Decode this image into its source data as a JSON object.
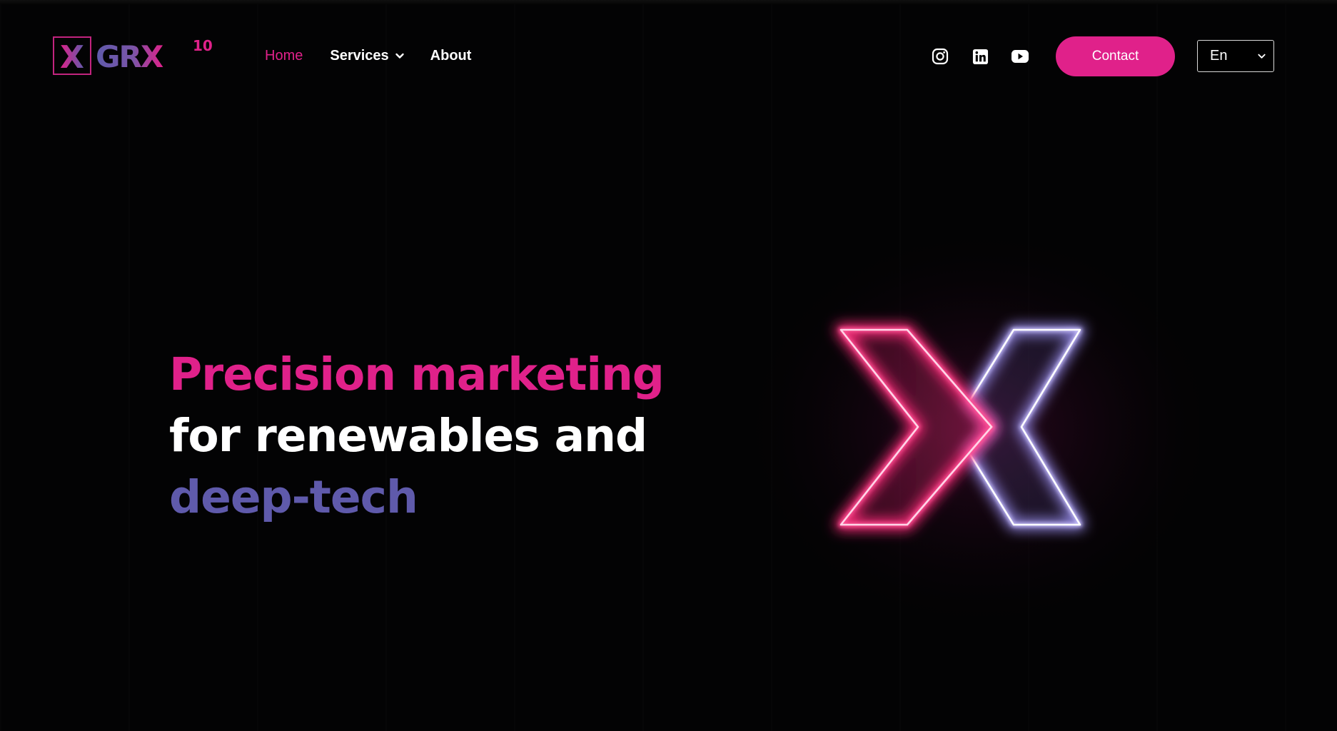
{
  "brand": {
    "logo_text": "GRX",
    "logo_superscript": "10",
    "logo_mark": "X"
  },
  "nav": {
    "items": [
      {
        "label": "Home",
        "active": true
      },
      {
        "label": "Services",
        "has_dropdown": true
      },
      {
        "label": "About"
      }
    ]
  },
  "social": [
    {
      "icon": "instagram-icon"
    },
    {
      "icon": "linkedin-icon"
    },
    {
      "icon": "youtube-icon"
    }
  ],
  "contact_label": "Contact",
  "language": {
    "selected": "En"
  },
  "hero": {
    "line1": "Precision marketing",
    "line2": "for renewables and",
    "line3": "deep-tech"
  },
  "colors": {
    "accent_pink": "#e0218a",
    "accent_purple": "#5f5aab",
    "background": "#030304",
    "text": "#ffffff"
  }
}
